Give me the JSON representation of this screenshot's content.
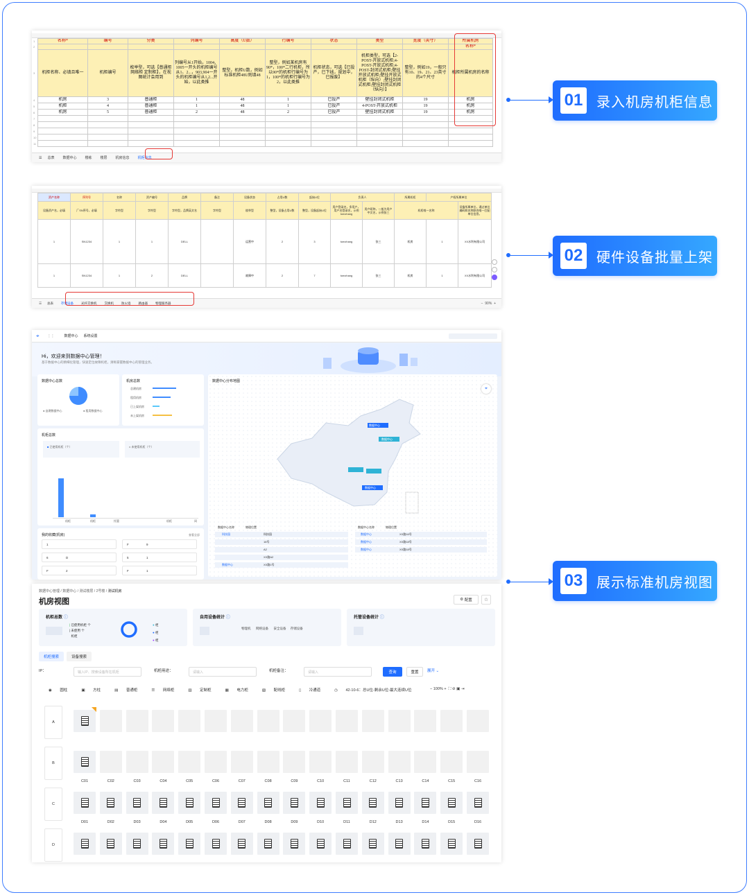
{
  "steps": [
    {
      "num": "01",
      "label": "录入机房机柜信息"
    },
    {
      "num": "02",
      "label": "硬件设备批量上架"
    },
    {
      "num": "03",
      "label": "展示标准机房视图"
    }
  ],
  "sheet1": {
    "col_letters": [
      "A",
      "B",
      "C",
      "D",
      "E",
      "F",
      "G",
      "H",
      "I",
      "J"
    ],
    "row_numbers": [
      "1",
      "2",
      "3",
      "4",
      "5",
      "6",
      "7",
      "8",
      "9",
      "10",
      "11"
    ],
    "header_row1": [
      "名称*",
      "编号",
      "分类",
      "列编号",
      "高度（U数）",
      "行编号",
      "状态",
      "类型",
      "宽度（英寸）",
      "所属机房"
    ],
    "header_row1b": "名称*",
    "desc_row": [
      "机柜名称、必填且唯一",
      "机柜编号",
      "枚举型，可选【普通柜 网络柜 定制柜】，在视图统计会用到",
      "列编号从1开始，1004、1005一开头的机柜编号从1、2...，903,904一开头的机柜编号从1,2...开始，以此类推",
      "整型，机柜U数，例如标准机柜48U则填48",
      "整型，例如某机房有90*，100*二行机柜，所以90*的机柜行编号为1，100*的机柜行编号为2，以此类推",
      "机柜状态，可选【已投产，已下线，规划中，已报废】",
      "机柜类型，可选【2-POST-开放式机柜;4-POST-开放式机柜;4-POST-封闭式机柜;壁挂开放式机柜;壁挂开放式机柜（纵向）;壁挂封闭式机柜;壁挂封闭式机柜（纵向）】",
      "整型，例如19，一般只有10、19、21、23英寸的4个尺寸",
      "机柜所属机房的名称"
    ],
    "data_rows": [
      [
        "机房",
        "3",
        "普通柜",
        "1",
        "48",
        "1",
        "已投产",
        "壁挂封闭式机柜",
        "19",
        "机房"
      ],
      [
        "机柜",
        "4",
        "普通柜",
        "1",
        "48",
        "1",
        "已投产",
        "4-POST-开放式机柜",
        "19",
        "机房"
      ],
      [
        "机房",
        "5",
        "普通柜",
        "2",
        "48",
        "2",
        "已投产",
        "壁挂封闭式机柜",
        "19",
        "机房"
      ]
    ],
    "tabs": [
      "总表",
      "数据中心",
      "楼栋",
      "楼层",
      "机房信息",
      "机柜信息"
    ],
    "active_tab": "机柜信息"
  },
  "sheet2": {
    "group_headers": [
      "资产名称",
      "序列号",
      "名称",
      "资产编号",
      "品牌",
      "备注",
      "设备状态",
      "占用U数",
      "起始U位",
      "负责人",
      "所属机柜",
      "产权所属单位"
    ],
    "sub_headers": [
      "用户名",
      "用户昵称",
      "名称",
      "编码",
      "名称"
    ],
    "desc_row": [
      "设备资产名，必填",
      "厂SN序号，必填",
      "字符型",
      "字符型",
      "字符型，品牌英文名",
      "字符型",
      "枚举型",
      "整型，设备占用U数",
      "整型，设备起始U位",
      "用户登录名，多用户，用户名登录名，示例tomzhang",
      "用户昵称，一般为用户中文名，示例张三",
      "机柜唯一名称",
      "设备所属单位，通过单位编码和名称联合唯一匹配单位信息。"
    ],
    "rows": [
      [
        "1",
        "SN1234",
        "1",
        "1",
        "DELL",
        "",
        "运营中",
        "2",
        "3",
        "tomzhang",
        "张三",
        "机房",
        "1",
        "XX水利有限公司"
      ],
      [
        "1",
        "SN1234",
        "1",
        "2",
        "DELL",
        "",
        "故障中",
        "2",
        "7",
        "tomzhang",
        "张三",
        "机房",
        "1",
        "XX水利有限公司"
      ]
    ],
    "tabs": [
      "总表",
      "存储设备",
      "光纤交换机",
      "交换机",
      "防火墙",
      "路由器",
      "物理服务器"
    ],
    "active_tab": "存储设备",
    "zoom": "90%"
  },
  "dashboard": {
    "nav": [
      "数据中心",
      "系统设置"
    ],
    "welcome": "Hi，欢迎来到数据中心管理！",
    "welcome_sub": "基于数据中心的精细化管理，快速定位故障机柜，清晰掌握数据中心的管理业务。",
    "cards": {
      "dc_total": "数据中心总数",
      "room_total": "机房总数",
      "map_title": "数据中心分布地图",
      "rack_total": "机柜总数",
      "used_rack": "已使用机柜（个）",
      "unused_rack": "未使用机柜（个）",
      "favorites": "我的收藏(机房)",
      "view_all": "查看全部"
    },
    "dc_legend": [
      "自建数据中心",
      "租用数据中心"
    ],
    "room_bars": [
      "总建机房",
      "租用机房",
      "已上架机房",
      "未上架机房"
    ],
    "bar_labels": [
      "机柜",
      "机柜",
      "托管",
      "机柜",
      "间"
    ],
    "fav_items": [
      [
        "1",
        "",
        "F",
        "9"
      ],
      [
        "6",
        "D",
        "5",
        "1"
      ],
      [
        "F",
        "2",
        "F",
        "1"
      ]
    ],
    "map_table_head": [
      "数据中心名称",
      "物理位置",
      "数据中心名称",
      "物理位置"
    ],
    "map_left_rows": [
      [
        "科技园",
        "科技园"
      ],
      [
        "",
        "16号"
      ],
      [
        "",
        "A2"
      ],
      [
        "",
        "XX路A2"
      ],
      [
        "数据中心",
        "XX路1号"
      ]
    ],
    "map_right_rows": [
      [
        "数据中心",
        "XX路16号"
      ],
      [
        "数据中心",
        "XX路18号"
      ],
      [
        "数据中心",
        "XX路18号"
      ]
    ],
    "map_markers": [
      "数据中心",
      "数据中心",
      "数据中心"
    ]
  },
  "room_view": {
    "breadcrumb": [
      "数据中心管理",
      "数据中心",
      "测试楼层",
      "2号楼",
      "测试机房"
    ],
    "title": "机房视图",
    "config": "配置",
    "stats": [
      {
        "title": "机柜总数"
      },
      {
        "title": "自用设备统计"
      },
      {
        "title": "托管设备统计"
      }
    ],
    "rack_stat_items": [
      "已使用机柜",
      "未使用",
      "机柜",
      "个",
      "个"
    ],
    "rack_pie_items": [
      "柜",
      "柜",
      "柜"
    ],
    "device_items": [
      "物理机",
      "网络设备",
      "安全设备",
      "存储设备"
    ],
    "tabs": [
      "机柜搜索",
      "设备搜索"
    ],
    "filters": {
      "ip_label": "IP：",
      "ip_placeholder": "输入IP、搜索设备所在机柜",
      "usage_label": "机柜用途：",
      "usage_placeholder": "请输入",
      "remark_label": "机柜备注：",
      "remark_placeholder": "请输入",
      "query": "查询",
      "reset": "重置",
      "expand": "展开"
    },
    "legend": [
      "圆柱",
      "方柱",
      "普通柜",
      "网络柜",
      "定制柜",
      "电力柜",
      "配线柜",
      "冷通道",
      "42-10-6：总U位-剩余U位-最大连续U位"
    ],
    "zoom": "100%",
    "rows": [
      "A",
      "B",
      "C",
      "D"
    ],
    "cols_c": [
      "C01",
      "C02",
      "C03",
      "C04",
      "C05",
      "C06",
      "C07",
      "C08",
      "C09",
      "C10",
      "C11",
      "C12",
      "C13",
      "C14",
      "C15",
      "C16"
    ],
    "cols_d": [
      "D01",
      "D02",
      "D03",
      "D04",
      "D05",
      "D06",
      "D07",
      "D08",
      "D09",
      "D10",
      "D11",
      "D12",
      "D13",
      "D14",
      "D15",
      "D16"
    ]
  },
  "colors": {
    "accent": "#1f6dff",
    "highlight_red": "#e53935",
    "header_yellow": "#fdf0b5"
  }
}
